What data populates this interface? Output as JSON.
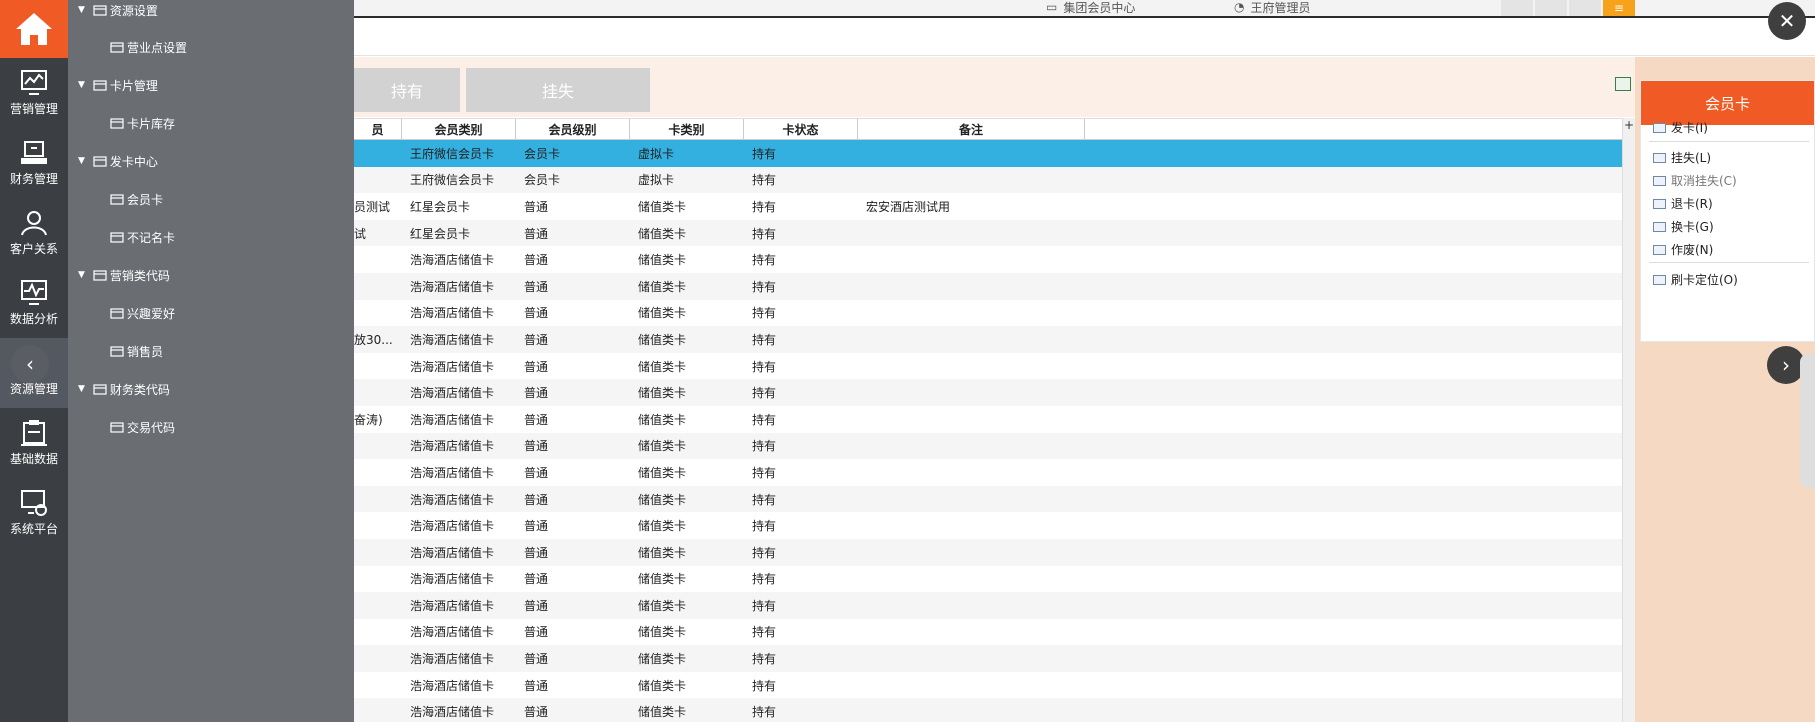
{
  "rail": {
    "items": [
      {
        "label": "营销管理",
        "icon": "chart-monitor-icon"
      },
      {
        "label": "财务管理",
        "icon": "cashier-icon"
      },
      {
        "label": "客户关系",
        "icon": "users-icon"
      },
      {
        "label": "数据分析",
        "icon": "analysis-icon"
      },
      {
        "label": "资源管理",
        "icon": "resource-icon"
      },
      {
        "label": "基础数据",
        "icon": "clipboard-icon"
      },
      {
        "label": "系统平台",
        "icon": "settings-monitor-icon"
      }
    ]
  },
  "submenu": {
    "items": [
      {
        "label": "资源设置",
        "icon": "gear-icon",
        "level": 1
      },
      {
        "label": "营业点设置",
        "icon": "network-icon",
        "level": 2
      },
      {
        "label": "卡片管理",
        "icon": "card-icon",
        "level": 1
      },
      {
        "label": "卡片库存",
        "icon": "card-stock-icon",
        "level": 2
      },
      {
        "label": "发卡中心",
        "icon": "card-issue-icon",
        "level": 1
      },
      {
        "label": "会员卡",
        "icon": "member-card-icon",
        "level": 2
      },
      {
        "label": "不记名卡",
        "icon": "anonymous-card-icon",
        "level": 2
      },
      {
        "label": "营销类代码",
        "icon": "code-icon",
        "level": 1
      },
      {
        "label": "兴趣爱好",
        "icon": "hobby-icon",
        "level": 2
      },
      {
        "label": "销售员",
        "icon": "salesman-icon",
        "level": 2
      },
      {
        "label": "财务类代码",
        "icon": "finance-code-icon",
        "level": 1
      },
      {
        "label": "交易代码",
        "icon": "list-icon",
        "level": 2
      }
    ]
  },
  "topbar": {
    "center_label": "集团会员中心",
    "user_label": "王府管理员"
  },
  "tabs": [
    {
      "label": "持有"
    },
    {
      "label": "挂失"
    }
  ],
  "grid": {
    "columns": [
      "员",
      "会员类别",
      "会员级别",
      "卡类别",
      "卡状态",
      "备注"
    ],
    "rows": [
      [
        "",
        "王府微信会员卡",
        "会员卡",
        "虚拟卡",
        "持有",
        ""
      ],
      [
        "",
        "王府微信会员卡",
        "会员卡",
        "虚拟卡",
        "持有",
        ""
      ],
      [
        "员测试",
        "红星会员卡",
        "普通",
        "储值类卡",
        "持有",
        "宏安酒店测试用"
      ],
      [
        "试",
        "红星会员卡",
        "普通",
        "储值类卡",
        "持有",
        ""
      ],
      [
        "",
        "浩海酒店储值卡",
        "普通",
        "储值类卡",
        "持有",
        ""
      ],
      [
        "",
        "浩海酒店储值卡",
        "普通",
        "储值类卡",
        "持有",
        ""
      ],
      [
        "",
        "浩海酒店储值卡",
        "普通",
        "储值类卡",
        "持有",
        ""
      ],
      [
        "放30...",
        "浩海酒店储值卡",
        "普通",
        "储值类卡",
        "持有",
        ""
      ],
      [
        "",
        "浩海酒店储值卡",
        "普通",
        "储值类卡",
        "持有",
        ""
      ],
      [
        "",
        "浩海酒店储值卡",
        "普通",
        "储值类卡",
        "持有",
        ""
      ],
      [
        "奋涛)",
        "浩海酒店储值卡",
        "普通",
        "储值类卡",
        "持有",
        ""
      ],
      [
        "",
        "浩海酒店储值卡",
        "普通",
        "储值类卡",
        "持有",
        ""
      ],
      [
        "",
        "浩海酒店储值卡",
        "普通",
        "储值类卡",
        "持有",
        ""
      ],
      [
        "",
        "浩海酒店储值卡",
        "普通",
        "储值类卡",
        "持有",
        ""
      ],
      [
        "",
        "浩海酒店储值卡",
        "普通",
        "储值类卡",
        "持有",
        ""
      ],
      [
        "",
        "浩海酒店储值卡",
        "普通",
        "储值类卡",
        "持有",
        ""
      ],
      [
        "",
        "浩海酒店储值卡",
        "普通",
        "储值类卡",
        "持有",
        ""
      ],
      [
        "",
        "浩海酒店储值卡",
        "普通",
        "储值类卡",
        "持有",
        ""
      ],
      [
        "",
        "浩海酒店储值卡",
        "普通",
        "储值类卡",
        "持有",
        ""
      ],
      [
        "",
        "浩海酒店储值卡",
        "普通",
        "储值类卡",
        "持有",
        ""
      ],
      [
        "",
        "浩海酒店储值卡",
        "普通",
        "储值类卡",
        "持有",
        ""
      ],
      [
        "",
        "浩海酒店储值卡",
        "普通",
        "储值类卡",
        "持有",
        ""
      ]
    ]
  },
  "card_panel": {
    "title": "会员卡",
    "actions": [
      {
        "label": "发卡(I)",
        "muted": false
      },
      {
        "label": "挂失(L)",
        "muted": false
      },
      {
        "label": "取消挂失(C)",
        "muted": true
      },
      {
        "label": "退卡(R)",
        "muted": false
      },
      {
        "label": "换卡(G)",
        "muted": false
      },
      {
        "label": "作废(N)",
        "muted": false
      },
      {
        "label": "刷卡定位(O)",
        "muted": false
      }
    ]
  },
  "scroll_plus": "+",
  "colors": {
    "brand": "#f05a24",
    "selected_row": "#33b0e0",
    "rail_bg": "#3b3e42",
    "submenu_bg": "#6a6e73"
  }
}
